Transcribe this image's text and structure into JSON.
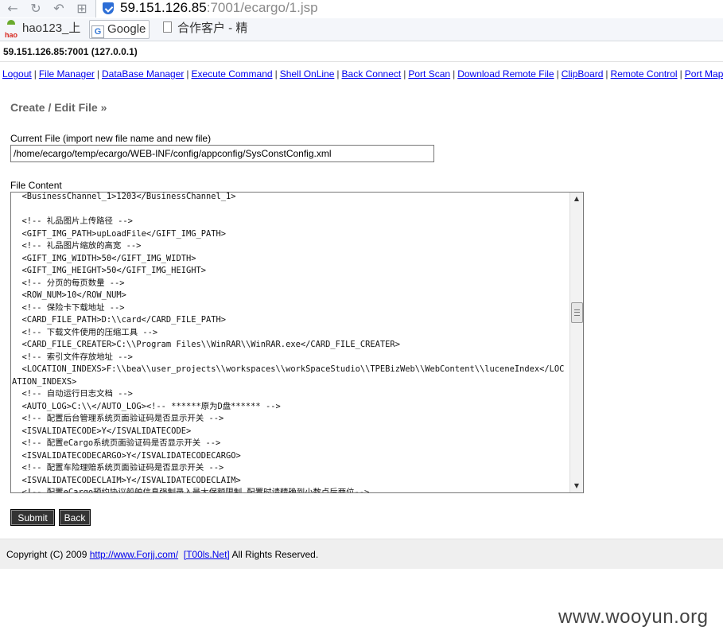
{
  "browser": {
    "url_host": "59.151.126.85",
    "url_rest": ":7001/ecargo/1.jsp",
    "bookmarks": [
      {
        "label": "hao123_上"
      },
      {
        "label": "Google"
      },
      {
        "label": "合作客户 - 精"
      }
    ]
  },
  "server_info": "59.151.126.85:7001 (127.0.0.1)",
  "menu": [
    "Logout",
    "File Manager",
    "DataBase Manager",
    "Execute Command",
    "Shell OnLine",
    "Back Connect",
    "Port Scan",
    "Download Remote File",
    "ClipBoard",
    "Remote Control",
    "Port Map"
  ],
  "form": {
    "title": "Create / Edit File »",
    "current_file_label": "Current File (import new file name and new file)",
    "current_file_value": "/home/ecargo/temp/ecargo/WEB-INF/config/appconfig/SysConstConfig.xml",
    "file_content_label": "File Content",
    "file_content": "  <BusinessChannel_1>1203</BusinessChannel_1>\n\n  <!-- 礼品图片上传路径 -->\n  <GIFT_IMG_PATH>upLoadFile</GIFT_IMG_PATH>\n  <!-- 礼品图片缩放的高宽 -->\n  <GIFT_IMG_WIDTH>50</GIFT_IMG_WIDTH>\n  <GIFT_IMG_HEIGHT>50</GIFT_IMG_HEIGHT>\n  <!-- 分页的每页数量 -->\n  <ROW_NUM>10</ROW_NUM>\n  <!-- 保险卡下载地址 -->\n  <CARD_FILE_PATH>D:\\\\card</CARD_FILE_PATH>\n  <!-- 下载文件使用的压缩工具 -->\n  <CARD_FILE_CREATER>C:\\\\Program Files\\\\WinRAR\\\\WinRAR.exe</CARD_FILE_CREATER>\n  <!-- 索引文件存放地址 -->\n  <LOCATION_INDEXS>F:\\\\bea\\\\user_projects\\\\workspaces\\\\workSpaceStudio\\\\TPEBizWeb\\\\WebContent\\\\luceneIndex</LOCATION_INDEXS>\n  <!-- 自动运行日志文档 -->\n  <AUTO_LOG>C:\\\\</AUTO_LOG><!-- ******原为D盘****** -->\n  <!-- 配置后台管理系统页面验证码是否显示开关 -->\n  <ISVALIDATECODE>Y</ISVALIDATECODE>\n  <!-- 配置eCargo系统页面验证码是否显示开关 -->\n  <ISVALIDATECODECARGO>Y</ISVALIDATECODECARGO>\n  <!-- 配置车险理赔系统页面验证码是否显示开关 -->\n  <ISVALIDATECODECLAIM>Y</ISVALIDATECODECLAIM>\n  <!-- 配置eCargo预约协议船舶信息强制录入最大保额限制,配置时请精确到小数点后两位-->",
    "submit_label": "Submit",
    "back_label": "Back"
  },
  "footer": {
    "prefix": "Copyright (C) 2009 ",
    "link1": "http://www.Forjj.com/",
    "link2": "[T00ls.Net]",
    "suffix": " All Rights Reserved."
  },
  "watermark": "www.wooyun.org"
}
